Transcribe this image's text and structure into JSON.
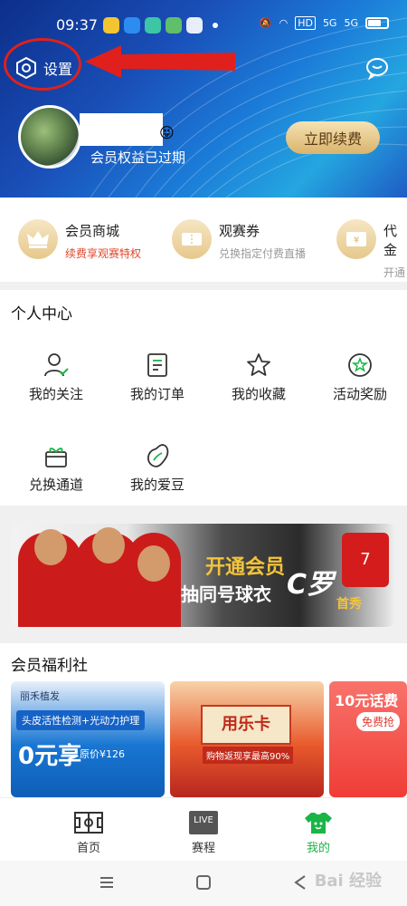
{
  "status_bar": {
    "time": "09:37",
    "hd": "HD",
    "net1": "5G",
    "net2": "5G"
  },
  "header": {
    "settings_label": "设置",
    "member_status": "会员权益已过期",
    "renew_label": "立即续费",
    "emoji": "😝"
  },
  "benefits": [
    {
      "title": "会员商城",
      "subtitle": "续费享观赛特权",
      "subtitle_color": "#e0452a"
    },
    {
      "title": "观赛券",
      "subtitle": "兑换指定付费直播",
      "subtitle_color": "#999999"
    },
    {
      "title": "代金",
      "subtitle": "开通会",
      "subtitle_color": "#999999"
    }
  ],
  "personal_center": {
    "title": "个人中心",
    "items": [
      {
        "label": "我的关注",
        "icon": "user-check-icon"
      },
      {
        "label": "我的订单",
        "icon": "order-icon"
      },
      {
        "label": "我的收藏",
        "icon": "star-icon"
      },
      {
        "label": "活动奖励",
        "icon": "award-icon"
      },
      {
        "label": "兑换通道",
        "icon": "gift-icon"
      },
      {
        "label": "我的爱豆",
        "icon": "bean-icon"
      }
    ]
  },
  "banner": {
    "line1": "开通会员",
    "line2": "抽同号球衣",
    "line3": "C罗",
    "line4": "首秀",
    "jersey_number": "7"
  },
  "welfare": {
    "title": "会员福利社",
    "card1": {
      "brand": "丽禾植发",
      "service": "头皮活性检测+光动力护理",
      "price_big": "0元享",
      "price_orig": "原价¥126"
    },
    "card2": {
      "title": "用乐卡",
      "subtitle": "购物返现享最高90%"
    },
    "card3": {
      "title": "10元话费",
      "button": "免费抢"
    }
  },
  "tabbar": [
    {
      "label": "首页",
      "icon": "home-field-icon",
      "active": false
    },
    {
      "label": "赛程",
      "icon": "live-icon",
      "icon_text": "LIVE",
      "active": false
    },
    {
      "label": "我的",
      "icon": "mine-shirt-icon",
      "active": true
    }
  ],
  "watermark": "Bai 经验",
  "colors": {
    "accent_green": "#1ab547",
    "gold": "#d9b46b",
    "annotation_red": "#e0201c"
  }
}
